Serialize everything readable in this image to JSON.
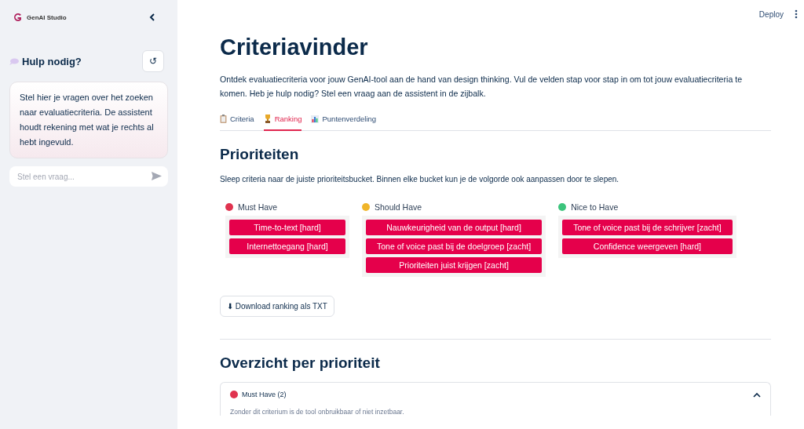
{
  "sidebar": {
    "brand": "GenAI Studio",
    "help_title": "Hulp nodig?",
    "reset_button": "↺",
    "message": "Stel hier je vragen over het zoeken naar evaluatiecriteria. De assistent houdt rekening met wat je rechts al hebt ingevuld.",
    "chat_input": {
      "placeholder": "Stel een vraag..."
    }
  },
  "header": {
    "deploy": "Deploy"
  },
  "title": "Criteriavinder",
  "intro": "Ontdek evaluatiecriteria voor jouw GenAI-tool aan de hand van design thinking. Vul de velden stap voor stap in om tot jouw evaluatiecriteria te komen. Heb je hulp nodig? Stel een vraag aan de assistent in de zijbalk.",
  "tabs": [
    {
      "label": "Criteria",
      "kind": "clipboard",
      "selected": false
    },
    {
      "label": "Ranking",
      "kind": "trophy",
      "selected": true
    },
    {
      "label": "Puntenverdeling",
      "kind": "chart",
      "selected": false
    }
  ],
  "priorities": {
    "heading": "Prioriteiten",
    "instruction": "Sleep criteria naar de juiste prioriteitsbucket. Binnen elke bucket kun je de volgorde ook aanpassen door te slepen.",
    "buckets": [
      {
        "name": "Must Have",
        "color": "#e0334f",
        "items": [
          "Time-to-text [hard]",
          "Internettoegang [hard]"
        ]
      },
      {
        "name": "Should Have",
        "color": "#f0b52a",
        "items": [
          "Nauwkeurigheid van de output [hard]",
          "Tone of voice past bij de doelgroep [zacht]",
          "Prioriteiten juist krijgen [zacht]"
        ]
      },
      {
        "name": "Nice to Have",
        "color": "#3cc47c",
        "items": [
          "Tone of voice past bij de schrijver [zacht]",
          "Confidence weergeven [hard]"
        ]
      }
    ],
    "download_button": "⬇ Download ranking als TXT"
  },
  "overview": {
    "heading": "Overzicht per prioriteit",
    "expander": {
      "label": "Must Have (2)",
      "color": "#e0334f",
      "expanded": true,
      "description": "Zonder dit criterium is de tool onbruikbaar of niet inzetbaar."
    }
  }
}
